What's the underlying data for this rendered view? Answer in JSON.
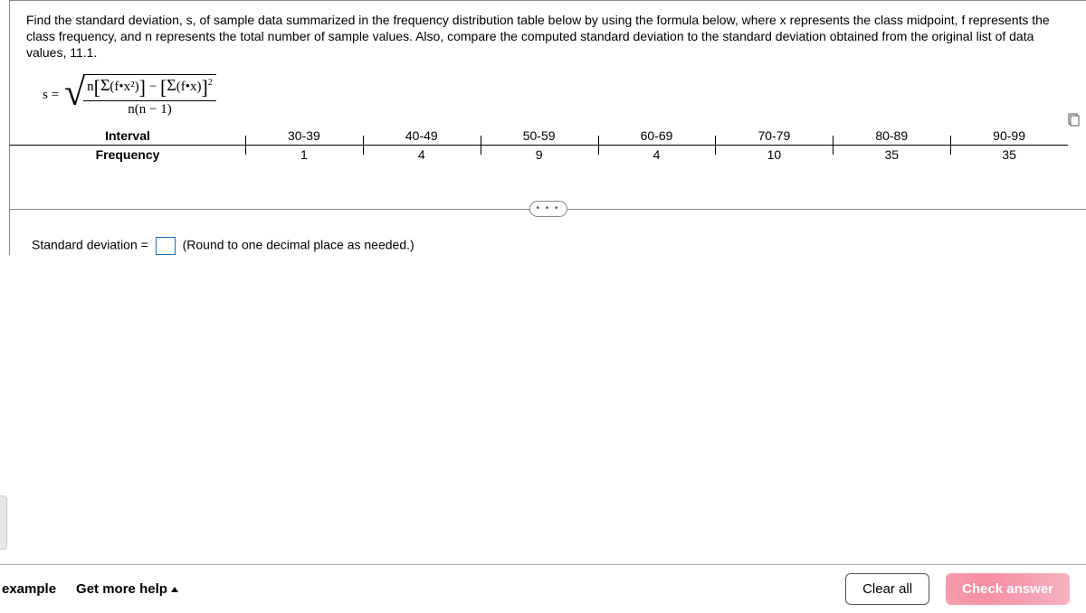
{
  "question": "Find the standard deviation, s, of sample data summarized in the frequency distribution table below by using the formula below, where x represents the class midpoint, f represents the class frequency, and n represents the total number of sample values. Also, compare the computed standard deviation to the standard deviation obtained from the original list of data values, 11.1.",
  "formula": {
    "lhs": "s =",
    "num": "n[Σ(f•x²)] − [Σ(f•x)]²",
    "den": "n(n − 1)"
  },
  "table": {
    "row_labels": {
      "interval": "Interval",
      "frequency": "Frequency"
    },
    "intervals": [
      "30-39",
      "40-49",
      "50-59",
      "60-69",
      "70-79",
      "80-89",
      "90-99"
    ],
    "frequencies": [
      "1",
      "4",
      "9",
      "4",
      "10",
      "35",
      "35"
    ]
  },
  "answer": {
    "label_before": "Standard deviation =",
    "value": "",
    "hint": "(Round to one decimal place as needed.)"
  },
  "footer": {
    "example": "example",
    "help": "Get more help",
    "clear": "Clear all",
    "check": "Check answer"
  },
  "collapse_dots": "• • •"
}
